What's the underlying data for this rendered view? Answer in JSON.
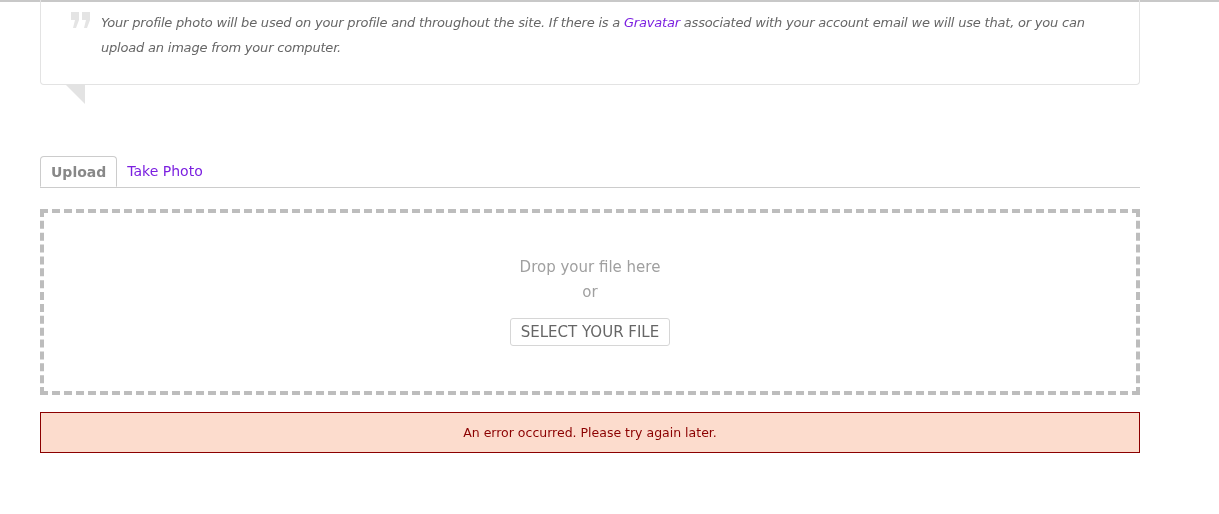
{
  "notice": {
    "text_before": "Your profile photo will be used on your profile and throughout the site. If there is a ",
    "link": "Gravatar",
    "text_after": " associated with your account email we will use that, or you can upload an image from your computer."
  },
  "tabs": [
    {
      "label": "Upload",
      "selected": true
    },
    {
      "label": "Take Photo",
      "selected": false
    }
  ],
  "dropzone": {
    "prompt": "Drop your file here",
    "separator": "or",
    "button": "SELECT YOUR FILE"
  },
  "error": "An error occurred. Please try again later."
}
